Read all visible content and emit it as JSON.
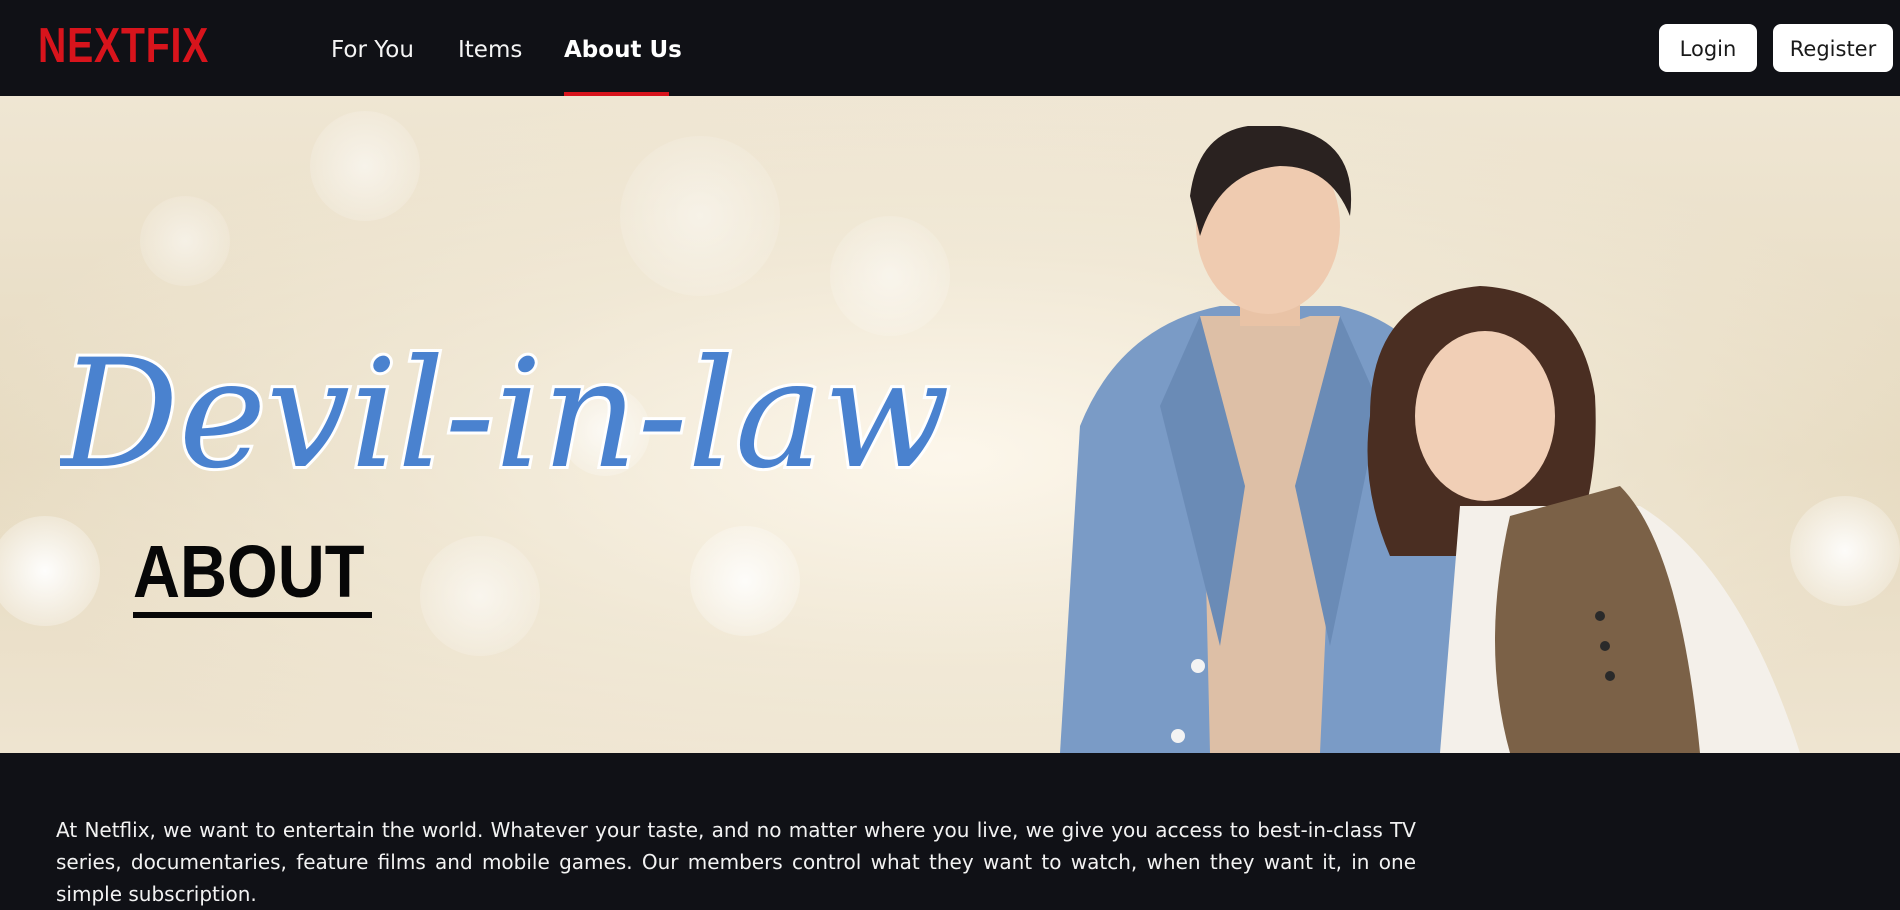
{
  "brand": {
    "logo_text": "NEXTFIX",
    "accent_color": "#d8141c"
  },
  "nav": {
    "links": [
      {
        "label": "For You",
        "active": false
      },
      {
        "label": "Items",
        "active": false
      },
      {
        "label": "About Us",
        "active": true
      }
    ],
    "login_label": "Login",
    "register_label": "Register"
  },
  "hero": {
    "title_logo_text": "Devil-in-law",
    "title_color": "#4a82cf",
    "heading": "ABOUT"
  },
  "about": {
    "paragraph": "At Netflix, we want to entertain the world. Whatever your taste, and no matter where you live, we give you access to best-in-class TV series, documentaries, feature films and mobile games. Our members control what they want to watch, when they want it, in one simple subscription."
  }
}
